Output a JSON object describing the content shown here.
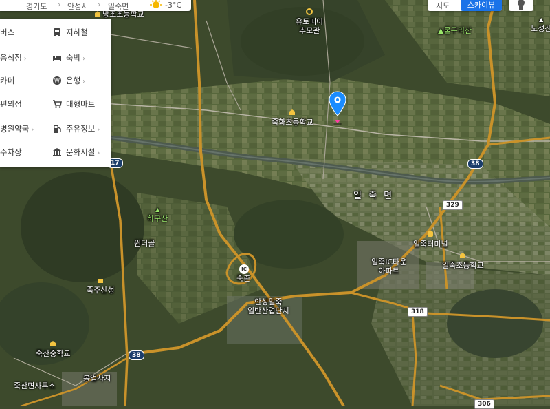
{
  "topbar": {
    "crumbs": [
      "경기도",
      "안성시",
      "일죽면"
    ],
    "temperature": "-3°C",
    "weather_icon": "sun-icon"
  },
  "map_toggle": {
    "map_label": "지도",
    "skyview_label": "스카이뷰"
  },
  "categories": {
    "left": [
      {
        "label": "버스",
        "chevron": false
      },
      {
        "label": "음식점",
        "chevron": true
      },
      {
        "label": "카페",
        "chevron": false
      },
      {
        "label": "편의점",
        "chevron": false
      },
      {
        "label": "병원약국",
        "chevron": true
      },
      {
        "label": "주차장",
        "chevron": false
      }
    ],
    "right": [
      {
        "label": "지하철",
        "icon": "subway-icon",
        "chevron": false
      },
      {
        "label": "숙박",
        "icon": "bed-icon",
        "chevron": true
      },
      {
        "label": "은행",
        "icon": "bank-icon",
        "chevron": true
      },
      {
        "label": "대형마트",
        "icon": "cart-icon",
        "chevron": false
      },
      {
        "label": "주유정보",
        "icon": "gas-station-icon",
        "chevron": true
      },
      {
        "label": "문화시설",
        "icon": "museum-icon",
        "chevron": true
      }
    ]
  },
  "places": {
    "school_top": "방초초등학교",
    "utopia_1": "유토피아",
    "utopia_2": "추모관",
    "mountain_1": "물구리산",
    "noseong": "노성산",
    "jukhwa_school": "죽화초등학교",
    "hagusan": "하구산",
    "wondeok": "원더골",
    "juksan_fortress": "죽주산성",
    "juksan_ms": "죽산중학교",
    "juksan_office": "죽산면사무소",
    "bongeop": "봉업사지",
    "ilsuk_region": "일 죽 면",
    "ilsuk_terminal": "일죽터미널",
    "ilsuk_apt_1": "일죽IC타운",
    "ilsuk_apt_2": "아파트",
    "ilsuk_school": "일죽초등학교",
    "industrial_1": "안성일죽",
    "industrial_2": "일반산업단지",
    "ic_label": "IC",
    "jukchon": "죽촌"
  },
  "shields": {
    "r17": "17",
    "r38a": "38",
    "r38b": "38",
    "r329": "329",
    "r318": "318",
    "r306": "306"
  },
  "colors": {
    "accent": "#1a73e8",
    "marker": "#1a8cff",
    "highway": "#c9922a"
  }
}
